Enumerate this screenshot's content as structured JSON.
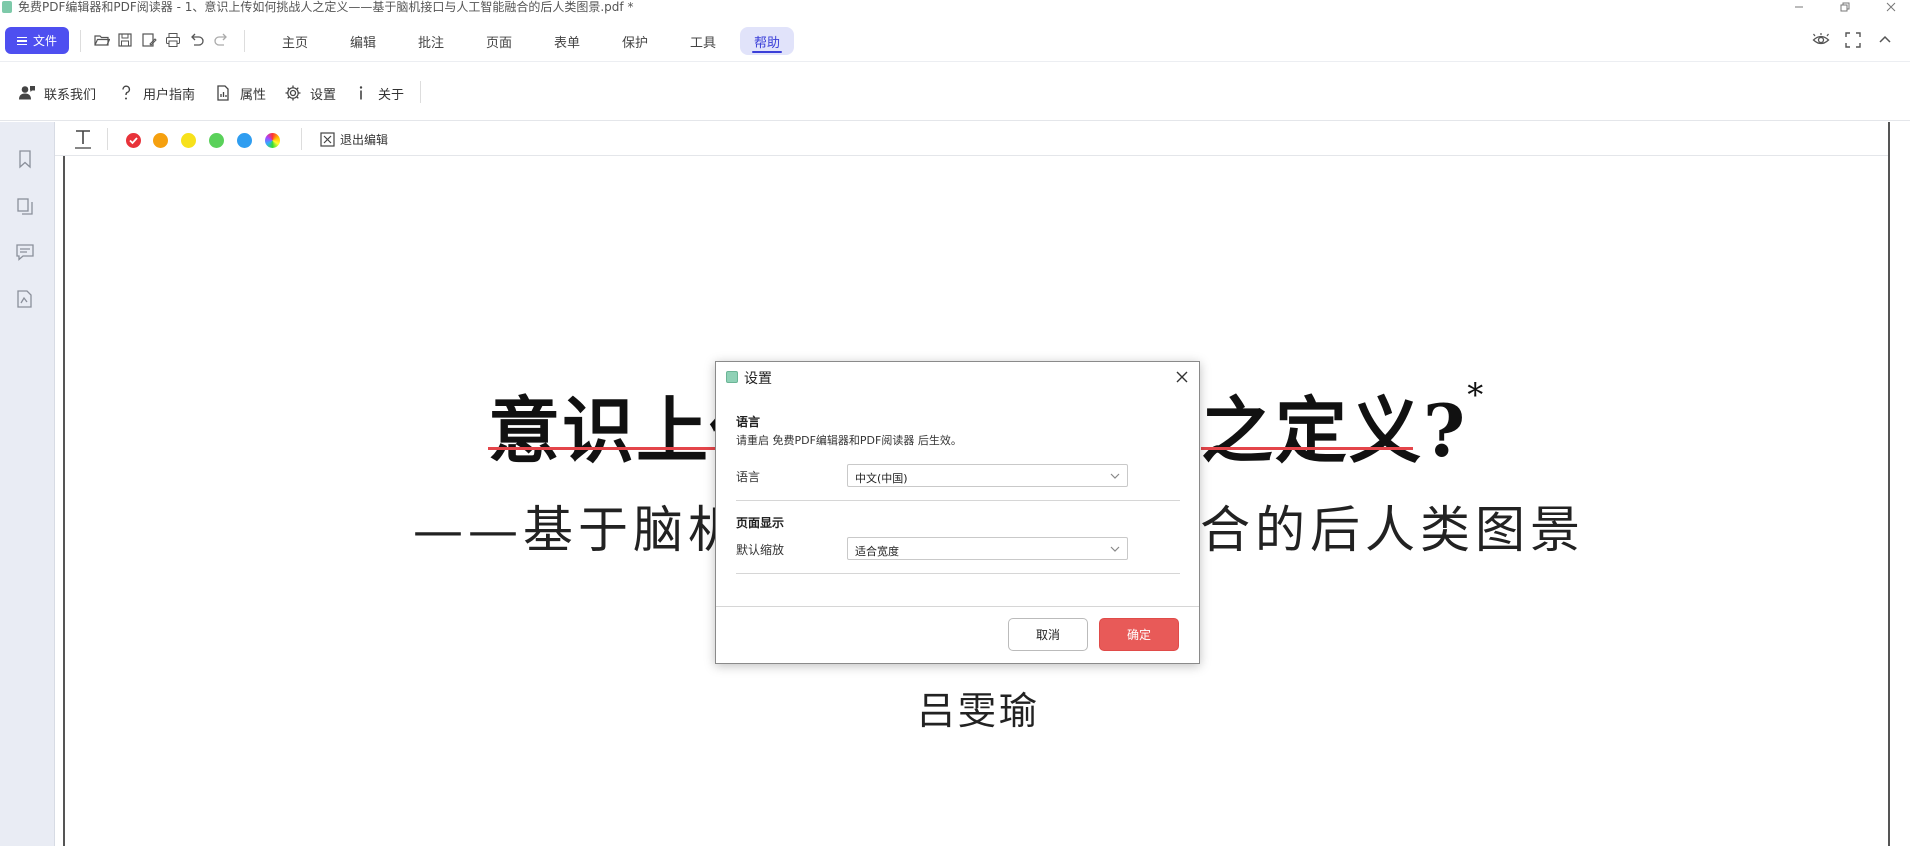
{
  "window": {
    "title": "免费PDF编辑器和PDF阅读器 - 1、意识上传如何挑战人之定义——基于脑机接口与人工智能融合的后人类图景.pdf *"
  },
  "menubar": {
    "file_label": "文件",
    "tabs": [
      "主页",
      "编辑",
      "批注",
      "页面",
      "表单",
      "保护",
      "工具",
      "帮助"
    ],
    "active_tab": "帮助"
  },
  "ribbon": {
    "items": [
      "联系我们",
      "用户指南",
      "属性",
      "设置",
      "关于"
    ]
  },
  "annotbar": {
    "colors": [
      "#e8333a",
      "#f5a00f",
      "#f7e11b",
      "#5ad15a",
      "#2f9df0"
    ],
    "exit_label": "退出编辑"
  },
  "document": {
    "title_left": "意识上传",
    "title_right": "之定义?",
    "title_mark": "*",
    "subtitle_left": "——基于脑机",
    "subtitle_right": "合的后人类图景",
    "author": "吕雯瑜"
  },
  "dialog": {
    "title": "设置",
    "language_section": "语言",
    "restart_note": "请重启 免费PDF编辑器和PDF阅读器 后生效。",
    "language_label": "语言",
    "language_value": "中文(中国)",
    "page_section": "页面显示",
    "zoom_label": "默认缩放",
    "zoom_value": "适合宽度",
    "cancel_label": "取消",
    "ok_label": "确定"
  }
}
